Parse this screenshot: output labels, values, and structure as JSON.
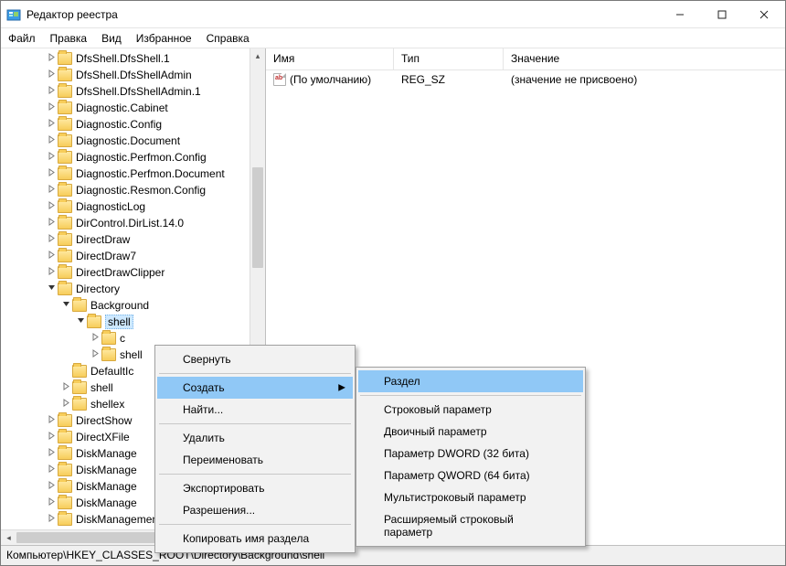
{
  "titlebar": {
    "title": "Редактор реестра"
  },
  "menubar": {
    "file": "Файл",
    "edit": "Правка",
    "view": "Вид",
    "favorites": "Избранное",
    "help": "Справка"
  },
  "tree": {
    "items": [
      {
        "indent": 3,
        "exp": ">",
        "label": "DfsShell.DfsShell.1"
      },
      {
        "indent": 3,
        "exp": ">",
        "label": "DfsShell.DfsShellAdmin"
      },
      {
        "indent": 3,
        "exp": ">",
        "label": "DfsShell.DfsShellAdmin.1"
      },
      {
        "indent": 3,
        "exp": ">",
        "label": "Diagnostic.Cabinet"
      },
      {
        "indent": 3,
        "exp": ">",
        "label": "Diagnostic.Config"
      },
      {
        "indent": 3,
        "exp": ">",
        "label": "Diagnostic.Document"
      },
      {
        "indent": 3,
        "exp": ">",
        "label": "Diagnostic.Perfmon.Config"
      },
      {
        "indent": 3,
        "exp": ">",
        "label": "Diagnostic.Perfmon.Document"
      },
      {
        "indent": 3,
        "exp": ">",
        "label": "Diagnostic.Resmon.Config"
      },
      {
        "indent": 3,
        "exp": ">",
        "label": "DiagnosticLog"
      },
      {
        "indent": 3,
        "exp": ">",
        "label": "DirControl.DirList.14.0"
      },
      {
        "indent": 3,
        "exp": ">",
        "label": "DirectDraw"
      },
      {
        "indent": 3,
        "exp": ">",
        "label": "DirectDraw7"
      },
      {
        "indent": 3,
        "exp": ">",
        "label": "DirectDrawClipper"
      },
      {
        "indent": 3,
        "exp": "v",
        "label": "Directory"
      },
      {
        "indent": 4,
        "exp": "v",
        "label": "Background"
      },
      {
        "indent": 5,
        "exp": "v",
        "label": "shell",
        "selected": true
      },
      {
        "indent": 6,
        "exp": ">",
        "label": "c"
      },
      {
        "indent": 6,
        "exp": ">",
        "label": "shell"
      },
      {
        "indent": 4,
        "exp": "",
        "label": "DefaultIc"
      },
      {
        "indent": 4,
        "exp": ">",
        "label": "shell"
      },
      {
        "indent": 4,
        "exp": ">",
        "label": "shellex"
      },
      {
        "indent": 3,
        "exp": ">",
        "label": "DirectShow"
      },
      {
        "indent": 3,
        "exp": ">",
        "label": "DirectXFile"
      },
      {
        "indent": 3,
        "exp": ">",
        "label": "DiskManage"
      },
      {
        "indent": 3,
        "exp": ">",
        "label": "DiskManage"
      },
      {
        "indent": 3,
        "exp": ">",
        "label": "DiskManage"
      },
      {
        "indent": 3,
        "exp": ">",
        "label": "DiskManage"
      },
      {
        "indent": 3,
        "exp": ">",
        "label": "DiskManagement.SnapInAbout"
      }
    ]
  },
  "list": {
    "headers": {
      "name": "Имя",
      "type": "Тип",
      "value": "Значение"
    },
    "row": {
      "name": "(По умолчанию)",
      "type": "REG_SZ",
      "value": "(значение не присвоено)"
    },
    "col_widths": {
      "name": 140,
      "type": 120,
      "value": 260
    }
  },
  "context_menu": {
    "collapse": "Свернуть",
    "create": "Создать",
    "find": "Найти...",
    "delete": "Удалить",
    "rename": "Переименовать",
    "export": "Экспортировать",
    "permissions": "Разрешения...",
    "copy_key_name": "Копировать имя раздела"
  },
  "submenu": {
    "key": "Раздел",
    "string": "Строковый параметр",
    "binary": "Двоичный параметр",
    "dword": "Параметр DWORD (32 бита)",
    "qword": "Параметр QWORD (64 бита)",
    "multi_string": "Мультистроковый параметр",
    "expand_string": "Расширяемый строковый параметр"
  },
  "statusbar": {
    "path": "Компьютер\\HKEY_CLASSES_ROOT\\Directory\\Background\\shell"
  }
}
